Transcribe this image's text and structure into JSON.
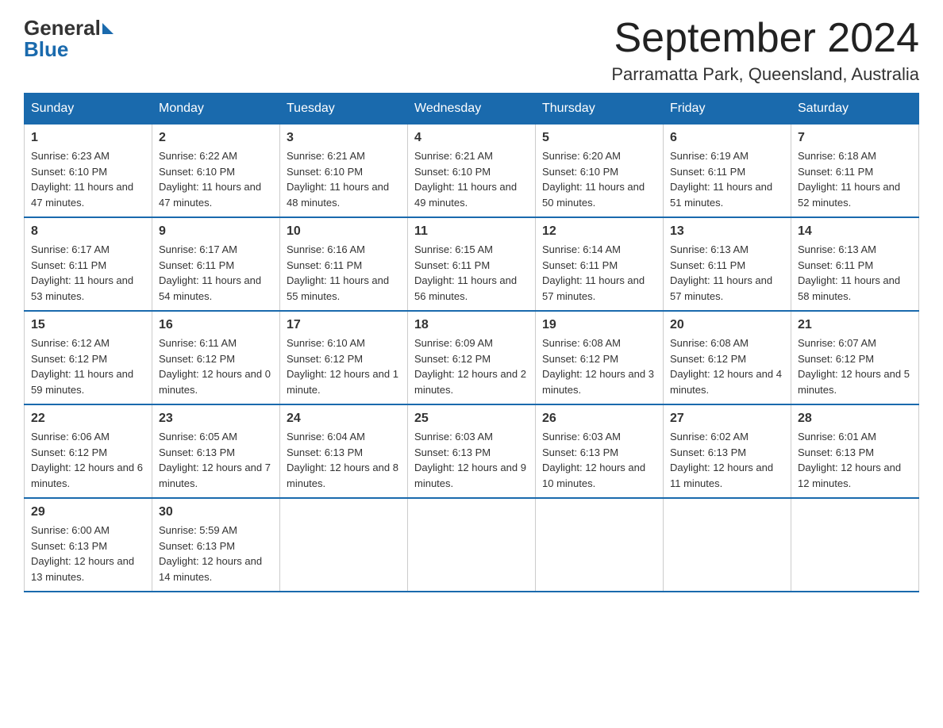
{
  "logo": {
    "general": "General",
    "blue": "Blue"
  },
  "title": "September 2024",
  "location": "Parramatta Park, Queensland, Australia",
  "days_of_week": [
    "Sunday",
    "Monday",
    "Tuesday",
    "Wednesday",
    "Thursday",
    "Friday",
    "Saturday"
  ],
  "weeks": [
    [
      {
        "day": "1",
        "sunrise": "6:23 AM",
        "sunset": "6:10 PM",
        "daylight": "11 hours and 47 minutes."
      },
      {
        "day": "2",
        "sunrise": "6:22 AM",
        "sunset": "6:10 PM",
        "daylight": "11 hours and 47 minutes."
      },
      {
        "day": "3",
        "sunrise": "6:21 AM",
        "sunset": "6:10 PM",
        "daylight": "11 hours and 48 minutes."
      },
      {
        "day": "4",
        "sunrise": "6:21 AM",
        "sunset": "6:10 PM",
        "daylight": "11 hours and 49 minutes."
      },
      {
        "day": "5",
        "sunrise": "6:20 AM",
        "sunset": "6:10 PM",
        "daylight": "11 hours and 50 minutes."
      },
      {
        "day": "6",
        "sunrise": "6:19 AM",
        "sunset": "6:11 PM",
        "daylight": "11 hours and 51 minutes."
      },
      {
        "day": "7",
        "sunrise": "6:18 AM",
        "sunset": "6:11 PM",
        "daylight": "11 hours and 52 minutes."
      }
    ],
    [
      {
        "day": "8",
        "sunrise": "6:17 AM",
        "sunset": "6:11 PM",
        "daylight": "11 hours and 53 minutes."
      },
      {
        "day": "9",
        "sunrise": "6:17 AM",
        "sunset": "6:11 PM",
        "daylight": "11 hours and 54 minutes."
      },
      {
        "day": "10",
        "sunrise": "6:16 AM",
        "sunset": "6:11 PM",
        "daylight": "11 hours and 55 minutes."
      },
      {
        "day": "11",
        "sunrise": "6:15 AM",
        "sunset": "6:11 PM",
        "daylight": "11 hours and 56 minutes."
      },
      {
        "day": "12",
        "sunrise": "6:14 AM",
        "sunset": "6:11 PM",
        "daylight": "11 hours and 57 minutes."
      },
      {
        "day": "13",
        "sunrise": "6:13 AM",
        "sunset": "6:11 PM",
        "daylight": "11 hours and 57 minutes."
      },
      {
        "day": "14",
        "sunrise": "6:13 AM",
        "sunset": "6:11 PM",
        "daylight": "11 hours and 58 minutes."
      }
    ],
    [
      {
        "day": "15",
        "sunrise": "6:12 AM",
        "sunset": "6:12 PM",
        "daylight": "11 hours and 59 minutes."
      },
      {
        "day": "16",
        "sunrise": "6:11 AM",
        "sunset": "6:12 PM",
        "daylight": "12 hours and 0 minutes."
      },
      {
        "day": "17",
        "sunrise": "6:10 AM",
        "sunset": "6:12 PM",
        "daylight": "12 hours and 1 minute."
      },
      {
        "day": "18",
        "sunrise": "6:09 AM",
        "sunset": "6:12 PM",
        "daylight": "12 hours and 2 minutes."
      },
      {
        "day": "19",
        "sunrise": "6:08 AM",
        "sunset": "6:12 PM",
        "daylight": "12 hours and 3 minutes."
      },
      {
        "day": "20",
        "sunrise": "6:08 AM",
        "sunset": "6:12 PM",
        "daylight": "12 hours and 4 minutes."
      },
      {
        "day": "21",
        "sunrise": "6:07 AM",
        "sunset": "6:12 PM",
        "daylight": "12 hours and 5 minutes."
      }
    ],
    [
      {
        "day": "22",
        "sunrise": "6:06 AM",
        "sunset": "6:12 PM",
        "daylight": "12 hours and 6 minutes."
      },
      {
        "day": "23",
        "sunrise": "6:05 AM",
        "sunset": "6:13 PM",
        "daylight": "12 hours and 7 minutes."
      },
      {
        "day": "24",
        "sunrise": "6:04 AM",
        "sunset": "6:13 PM",
        "daylight": "12 hours and 8 minutes."
      },
      {
        "day": "25",
        "sunrise": "6:03 AM",
        "sunset": "6:13 PM",
        "daylight": "12 hours and 9 minutes."
      },
      {
        "day": "26",
        "sunrise": "6:03 AM",
        "sunset": "6:13 PM",
        "daylight": "12 hours and 10 minutes."
      },
      {
        "day": "27",
        "sunrise": "6:02 AM",
        "sunset": "6:13 PM",
        "daylight": "12 hours and 11 minutes."
      },
      {
        "day": "28",
        "sunrise": "6:01 AM",
        "sunset": "6:13 PM",
        "daylight": "12 hours and 12 minutes."
      }
    ],
    [
      {
        "day": "29",
        "sunrise": "6:00 AM",
        "sunset": "6:13 PM",
        "daylight": "12 hours and 13 minutes."
      },
      {
        "day": "30",
        "sunrise": "5:59 AM",
        "sunset": "6:13 PM",
        "daylight": "12 hours and 14 minutes."
      },
      null,
      null,
      null,
      null,
      null
    ]
  ],
  "labels": {
    "sunrise_prefix": "Sunrise: ",
    "sunset_prefix": "Sunset: ",
    "daylight_prefix": "Daylight: "
  }
}
